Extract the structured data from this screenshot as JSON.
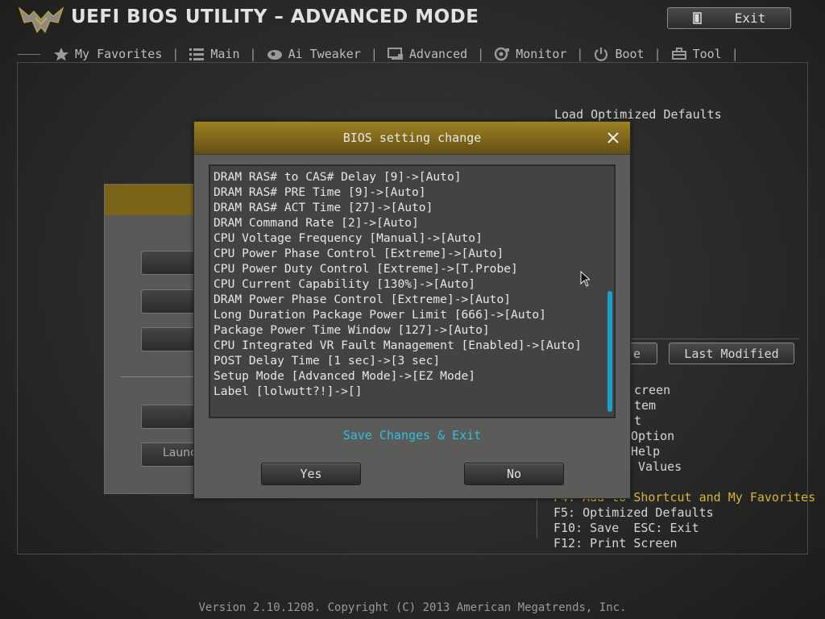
{
  "header": {
    "title": "UEFI BIOS UTILITY – ADVANCED MODE",
    "exit_label": "Exit"
  },
  "nav": {
    "tabs": [
      {
        "label": "My Favorites",
        "icon": "star-icon"
      },
      {
        "label": "Main",
        "icon": "list-icon"
      },
      {
        "label": "Ai Tweaker",
        "icon": "tweaker-icon"
      },
      {
        "label": "Advanced",
        "icon": "advanced-icon"
      },
      {
        "label": "Monitor",
        "icon": "monitor-icon"
      },
      {
        "label": "Boot",
        "icon": "power-icon"
      },
      {
        "label": "Tool",
        "icon": "tool-icon"
      }
    ]
  },
  "background": {
    "load_defaults": "Load Optimized Defaults",
    "partial_button": "e",
    "last_modified": "Last Modified",
    "launch_partial": "Launc",
    "help_lines": [
      "creen",
      "tem",
      "t",
      "Option",
      "Help",
      " Values",
      "F4: Add to Shortcut and My Favorites",
      "F5: Optimized Defaults",
      "F10: Save  ESC: Exit",
      "F12: Print Screen"
    ]
  },
  "dialog": {
    "title": "BIOS setting change",
    "changes": [
      "DRAM RAS# to CAS# Delay [9]->[Auto]",
      "DRAM RAS# PRE Time [9]->[Auto]",
      "DRAM RAS# ACT Time [27]->[Auto]",
      "DRAM Command Rate [2]->[Auto]",
      "CPU Voltage Frequency [Manual]->[Auto]",
      "CPU Power Phase Control [Extreme]->[Auto]",
      "CPU Power Duty Control [Extreme]->[T.Probe]",
      "CPU Current Capability [130%]->[Auto]",
      "DRAM Power Phase Control [Extreme]->[Auto]",
      "Long Duration Package Power Limit [666]->[Auto]",
      "Package Power Time Window [127]->[Auto]",
      "CPU Integrated VR Fault Management [Enabled]->[Auto]",
      "POST Delay Time [1 sec]->[3 sec]",
      "Setup Mode [Advanced Mode]->[EZ Mode]",
      "Label [lolwutt?!]->[]"
    ],
    "prompt": "Save Changes & Exit",
    "yes_label": "Yes",
    "no_label": "No"
  },
  "footer": {
    "text": "Version 2.10.1208. Copyright (C) 2013 American Megatrends, Inc."
  },
  "colors": {
    "accent_gold": "#7a6418",
    "prompt_cyan": "#2fc0e0",
    "scroll_blue": "#1aa0c8",
    "help_highlight": "#d7b43a"
  }
}
